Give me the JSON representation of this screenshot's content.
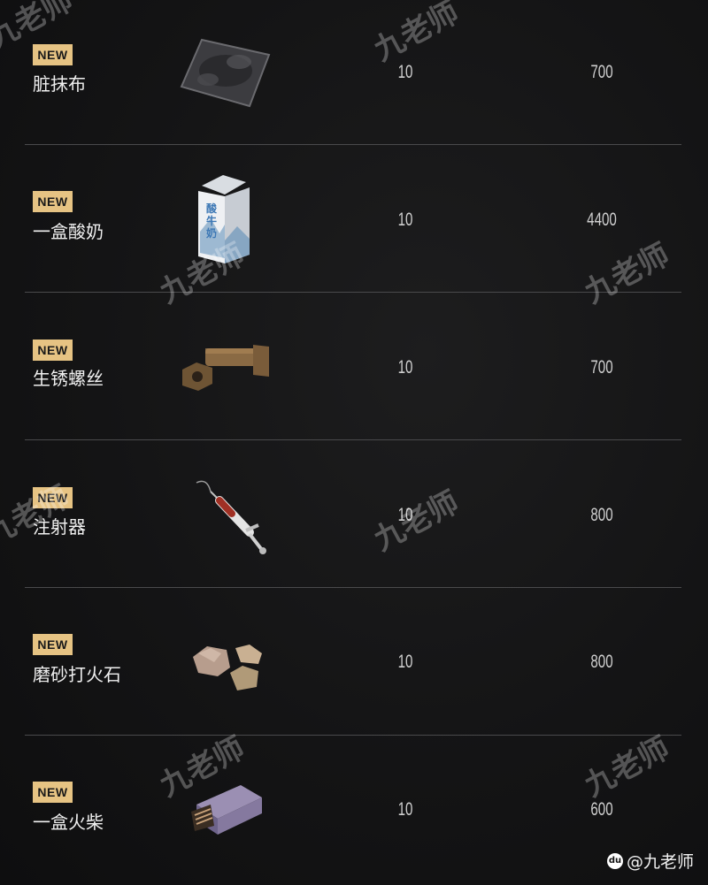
{
  "items": [
    {
      "badge": "NEW",
      "name": "脏抹布",
      "qty": "10",
      "price": "700",
      "icon": "dirty-rag-icon"
    },
    {
      "badge": "NEW",
      "name": "一盒酸奶",
      "qty": "10",
      "price": "4400",
      "icon": "yogurt-carton-icon",
      "carton_text": "酸牛奶"
    },
    {
      "badge": "NEW",
      "name": "生锈螺丝",
      "qty": "10",
      "price": "700",
      "icon": "rusty-bolt-icon"
    },
    {
      "badge": "NEW",
      "name": "注射器",
      "qty": "10",
      "price": "800",
      "icon": "syringe-icon"
    },
    {
      "badge": "NEW",
      "name": "磨砂打火石",
      "qty": "10",
      "price": "800",
      "icon": "flint-stones-icon"
    },
    {
      "badge": "NEW",
      "name": "一盒火柴",
      "qty": "10",
      "price": "600",
      "icon": "matchbox-icon"
    }
  ],
  "watermark": "九老师",
  "credit": {
    "logo": "du",
    "text": "@九老师"
  }
}
